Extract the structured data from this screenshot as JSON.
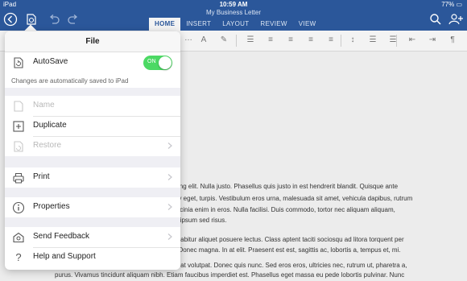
{
  "status_bar": {
    "carrier": "iPad",
    "time": "10:59 AM",
    "battery": "77%"
  },
  "doc_title": "My Business Letter",
  "tabs": [
    "HOME",
    "INSERT",
    "LAYOUT",
    "REVIEW",
    "VIEW"
  ],
  "panel": {
    "title": "File",
    "autosave": {
      "label": "AutoSave",
      "state": "ON",
      "note": "Changes are automatically saved to iPad"
    },
    "items": {
      "name": "Name",
      "duplicate": "Duplicate",
      "restore": "Restore",
      "print": "Print",
      "properties": "Properties",
      "send_feedback": "Send Feedback",
      "help": "Help and Support"
    }
  },
  "document": {
    "lines": [
      "cing elit. Nulla justo. Phasellus quis justo in est hendrerit blandit. Quisque ante",
      "ny eget, turpis. Vestibulum eros urna, malesuada sit amet, vehicula dapibus, rutrum",
      "lacinia enim in eros. Nulla facilisi. Duis commodo, tortor nec aliquam aliquam,",
      "n ipsum sed risus.",
      "urabitur aliquet posuere lectus. Class aptent taciti sociosqu ad litora torquent per",
      ". Donec magna. In at elit. Praesent est est, sagittis ac, lobortis a, tempus et, mi.",
      "erat volutpat. Donec quis nunc. Sed eros eros, ultricies nec, rutrum ut, pharetra a,",
      "purus. Vivamus tincidunt aliquam nibh. Etiam faucibus imperdiet est. Phasellus eget massa eu pede lobortis pulvinar. Nunc"
    ]
  },
  "colors": {
    "brand": "#2b579a",
    "toggle_on": "#4cd964"
  }
}
